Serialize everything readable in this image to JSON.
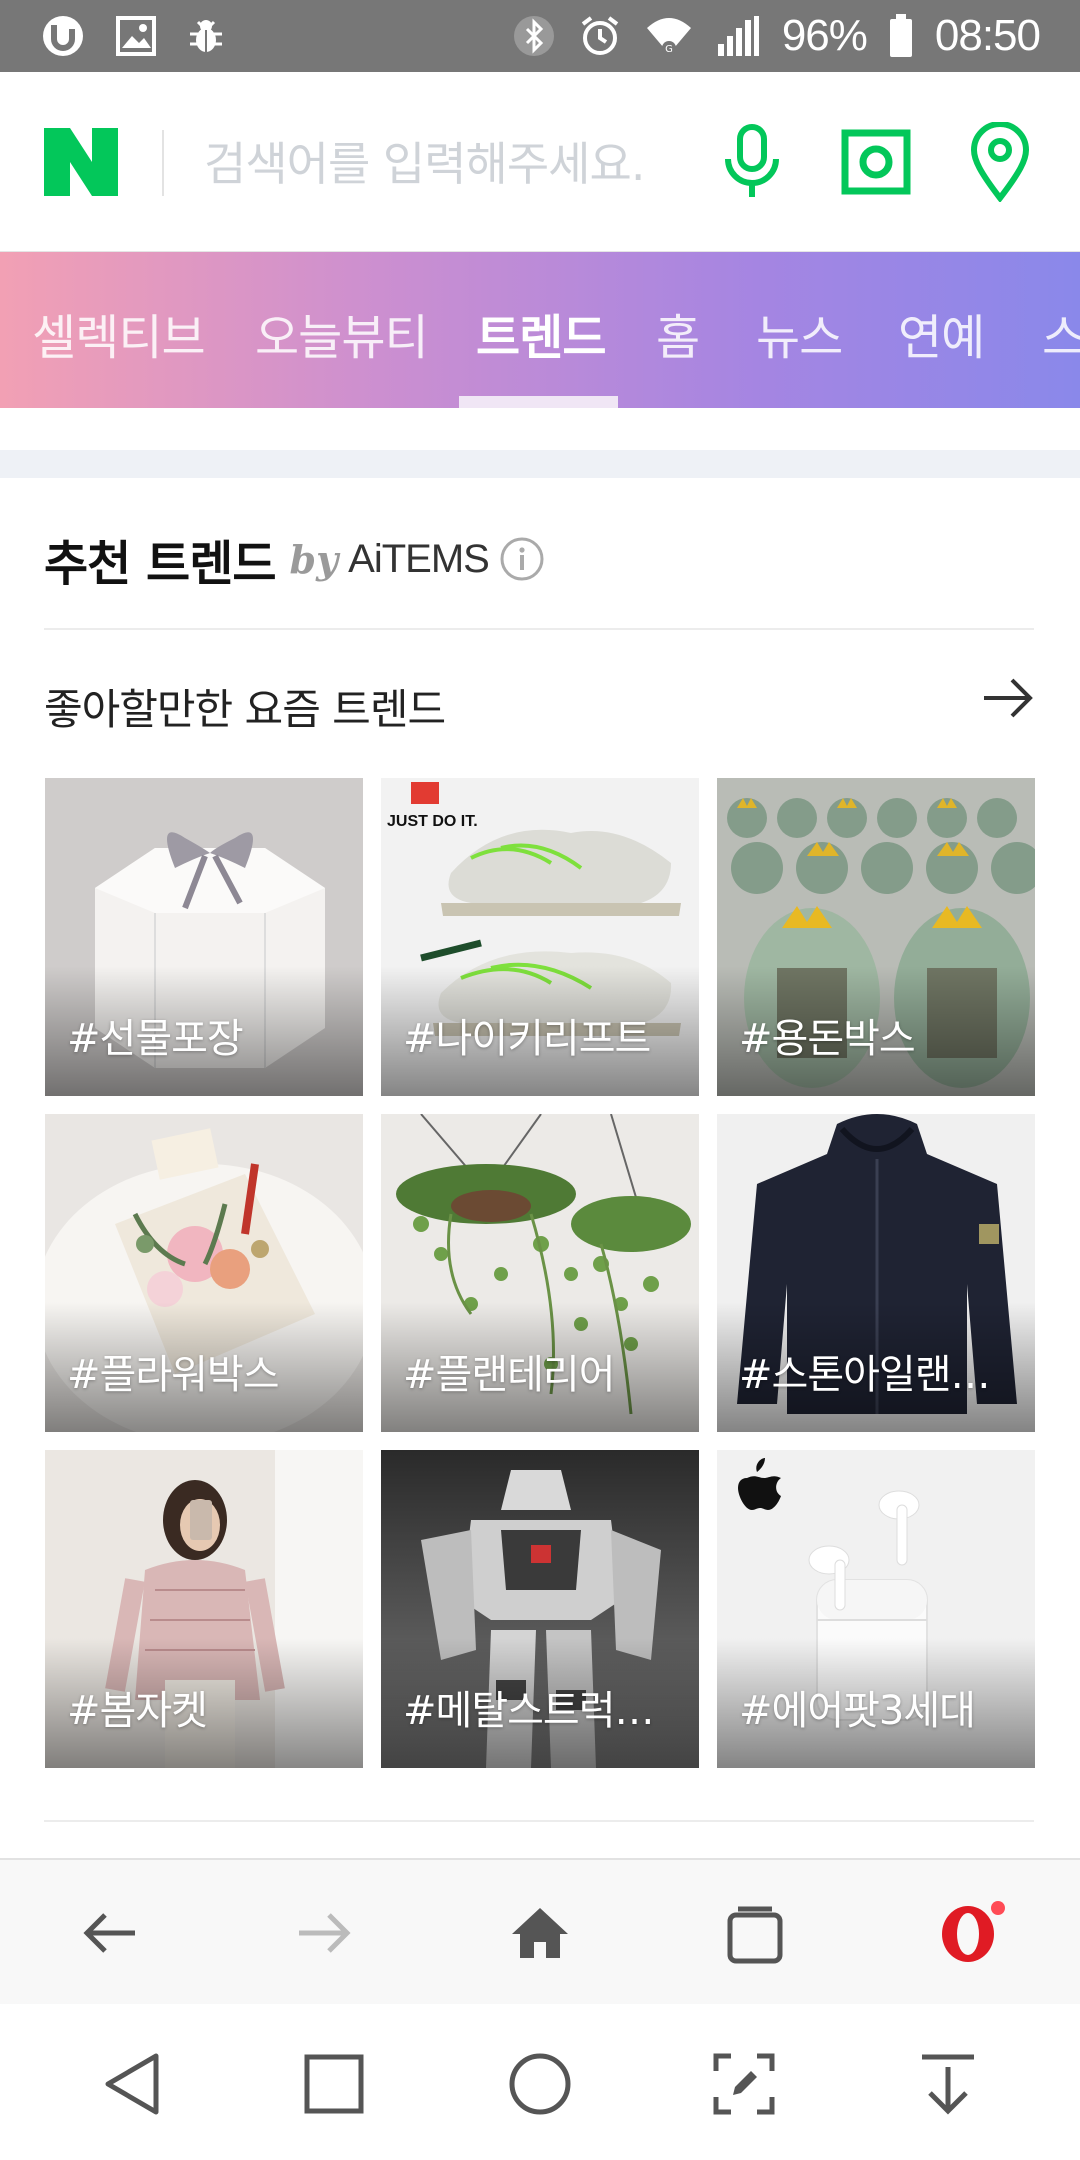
{
  "status_bar": {
    "battery_percent": "96%",
    "time": "08:50",
    "left_icons": [
      "notification-u-icon",
      "gallery-icon",
      "bug-icon"
    ],
    "right_icons": [
      "bluetooth-icon",
      "alarm-icon",
      "wifi-icon",
      "signal-icon",
      "battery-icon"
    ]
  },
  "search": {
    "logo": "N",
    "placeholder": "검색어를 입력해주세요.",
    "value": "",
    "icons": [
      "microphone-icon",
      "camera-lens-icon",
      "location-pin-icon"
    ],
    "accent_color": "#03c75a"
  },
  "tabs": [
    {
      "label": "셀렉티브",
      "active": false
    },
    {
      "label": "오늘뷰티",
      "active": false
    },
    {
      "label": "트렌드",
      "active": true
    },
    {
      "label": "홈",
      "active": false
    },
    {
      "label": "뉴스",
      "active": false
    },
    {
      "label": "연예",
      "active": false
    },
    {
      "label": "스",
      "active": false
    }
  ],
  "trend_card": {
    "title": "추천 트렌드",
    "by": "by",
    "brand": "AiTEMS",
    "subheading": "좋아할만한 요즘 트렌드",
    "items": [
      {
        "tag": "#선물포장",
        "image_caption": ""
      },
      {
        "tag": "#나이키리프트",
        "image_caption": "JUST DO IT."
      },
      {
        "tag": "#용돈박스",
        "image_caption": ""
      },
      {
        "tag": "#플라워박스",
        "image_caption": ""
      },
      {
        "tag": "#플랜테리어",
        "image_caption": ""
      },
      {
        "tag": "#스톤아일랜드후드",
        "image_caption": ""
      },
      {
        "tag": "#봄자켓",
        "image_caption": ""
      },
      {
        "tag": "#메탈스트럭쳐건담",
        "image_caption": ""
      },
      {
        "tag": "#에어팟3세대",
        "image_caption": ""
      }
    ]
  },
  "browser_toolbar": {
    "buttons": [
      "back-arrow-icon",
      "forward-arrow-icon",
      "home-icon",
      "tabs-icon",
      "opera-icon"
    ],
    "forward_enabled": false,
    "opera_badge_color": "#ff4b55"
  },
  "nav_bar": {
    "buttons": [
      "back-triangle-icon",
      "recents-square-icon",
      "home-circle-icon",
      "capture-edit-icon",
      "download-arrow-icon"
    ]
  }
}
